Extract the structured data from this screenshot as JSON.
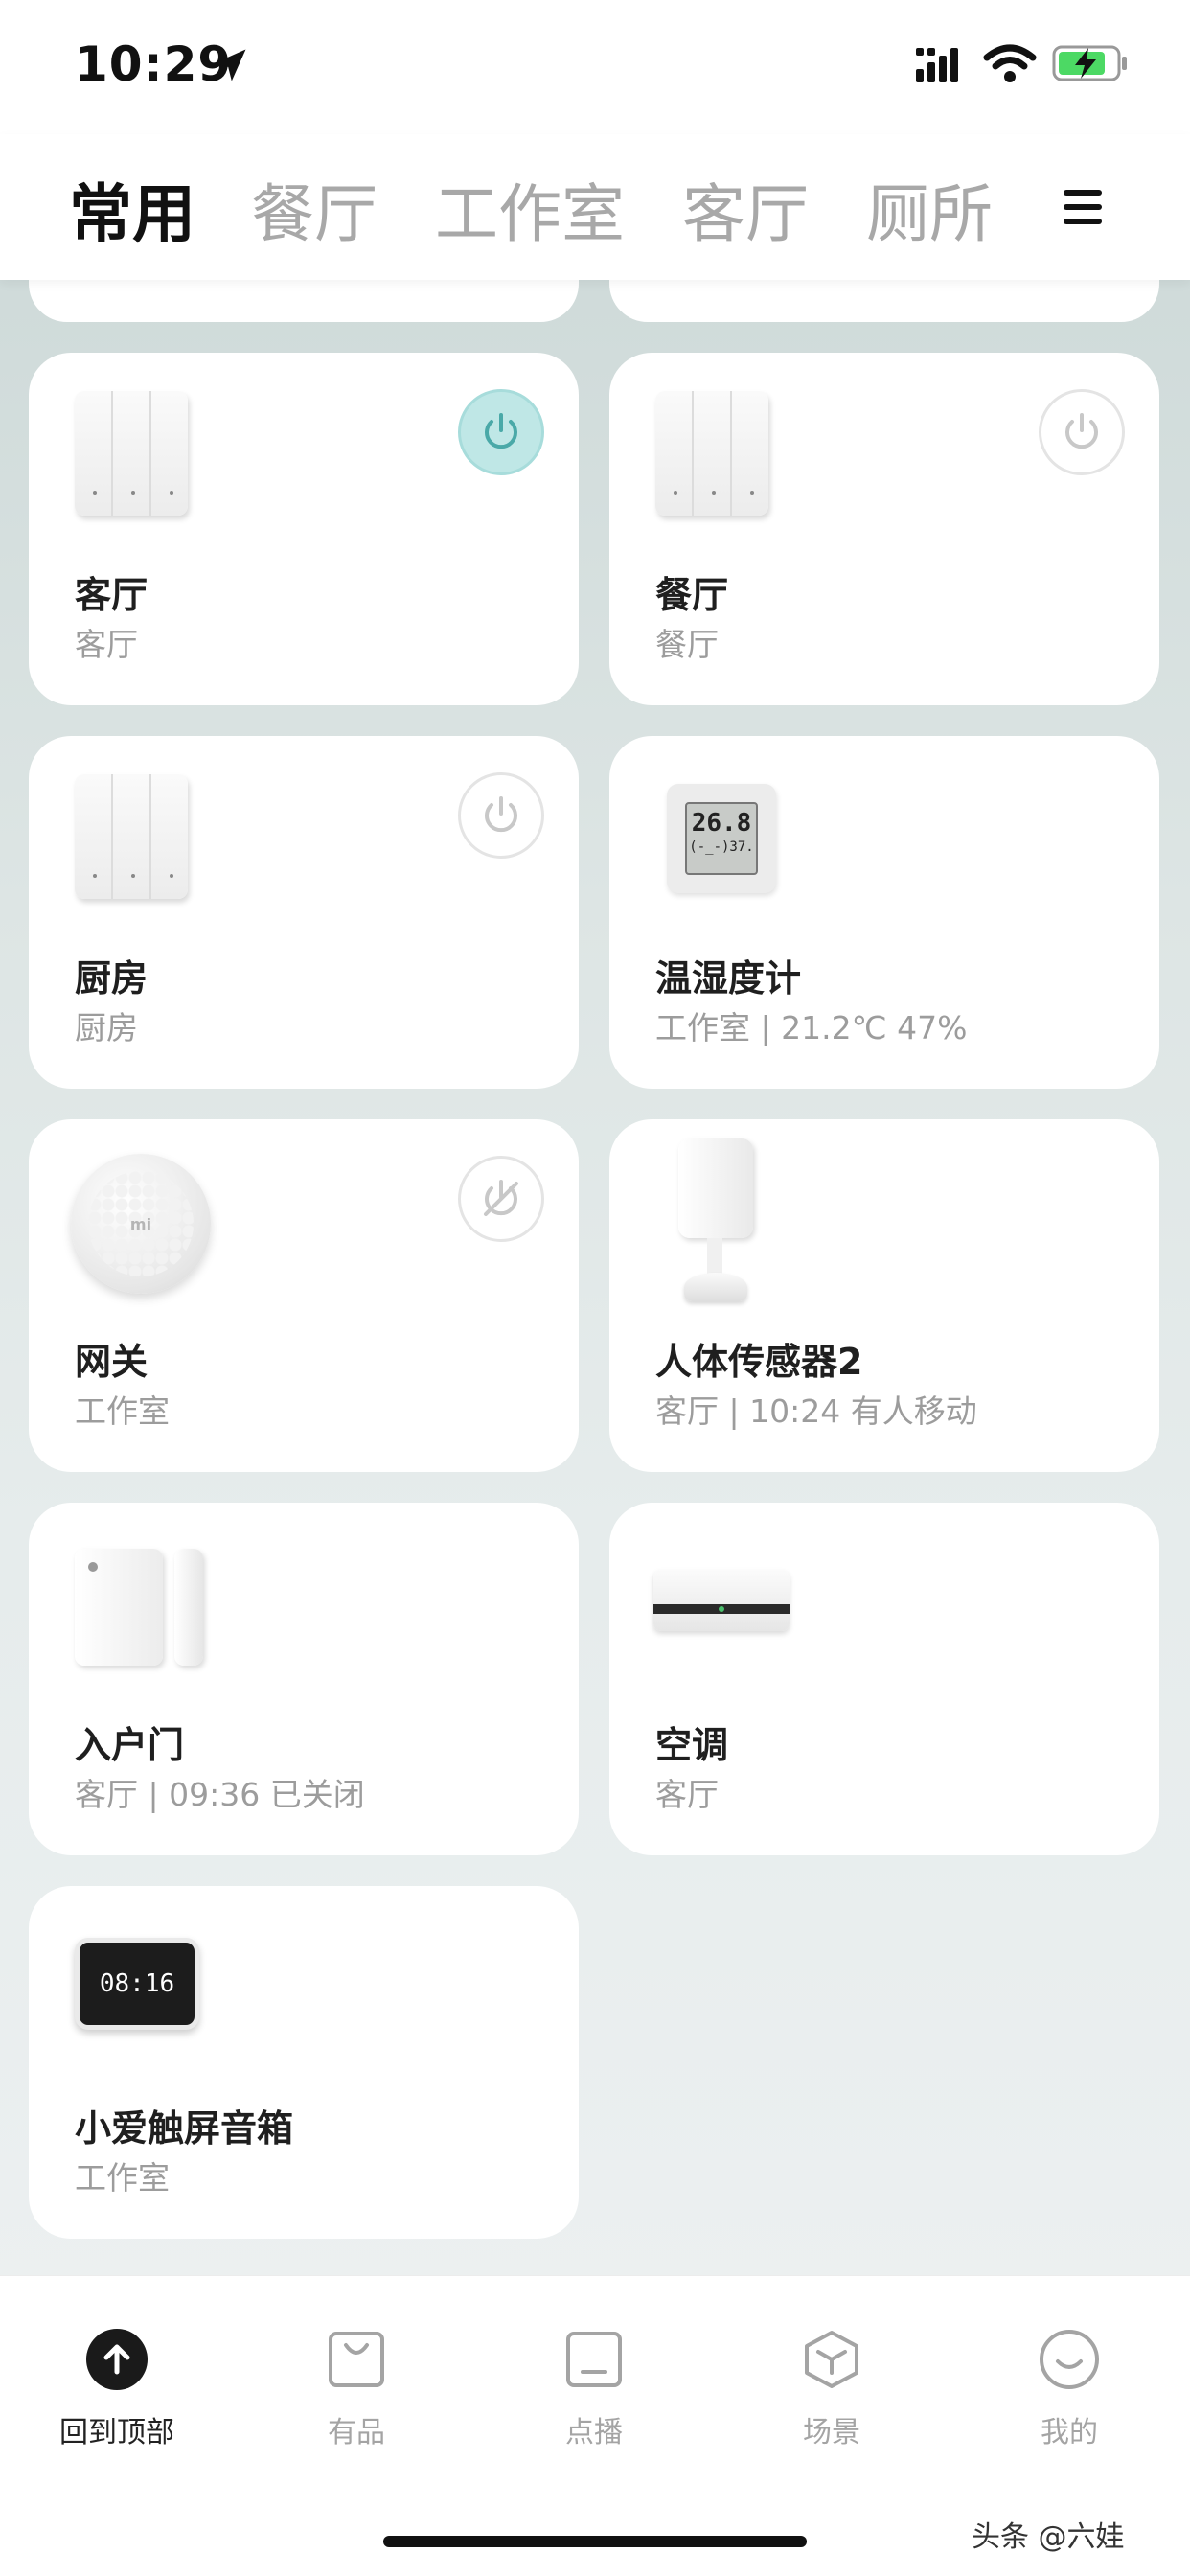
{
  "status_bar": {
    "time": "10:29"
  },
  "tabs": [
    {
      "label": "常用",
      "active": true
    },
    {
      "label": "餐厅",
      "active": false
    },
    {
      "label": "工作室",
      "active": false
    },
    {
      "label": "客厅",
      "active": false
    },
    {
      "label": "厕所",
      "active": false
    }
  ],
  "devices": [
    {
      "name": "客厅",
      "sub": "客厅",
      "power": "on"
    },
    {
      "name": "餐厅",
      "sub": "餐厅",
      "power": "off"
    },
    {
      "name": "厨房",
      "sub": "厨房",
      "power": "off"
    },
    {
      "name": "温湿度计",
      "sub": "工作室 | 21.2℃ 47%",
      "display_top": "26.8",
      "display_bottom": "(-_-)37."
    },
    {
      "name": "网关",
      "sub": "工作室",
      "power": "offline",
      "logo": "mi"
    },
    {
      "name": "人体传感器2",
      "sub": "客厅 | 10:24 有人移动"
    },
    {
      "name": "入户门",
      "sub": "客厅 | 09:36 已关闭"
    },
    {
      "name": "空调",
      "sub": "客厅"
    },
    {
      "name": "小爱触屏音箱",
      "sub": "工作室",
      "display": "08:16"
    }
  ],
  "bottom_nav": [
    {
      "label": "回到顶部",
      "icon": "arrow-up-icon",
      "active": true
    },
    {
      "label": "有品",
      "icon": "shopping-bag-icon",
      "active": false
    },
    {
      "label": "点播",
      "icon": "video-icon",
      "active": false
    },
    {
      "label": "场景",
      "icon": "cube-icon",
      "active": false
    },
    {
      "label": "我的",
      "icon": "smiley-icon",
      "active": false
    }
  ],
  "watermark": "头条 @六娃",
  "colors": {
    "power_on_bg": "#bfe7e6",
    "power_on_icon": "#4aa9a8",
    "power_off_icon": "#c8c8c8"
  }
}
